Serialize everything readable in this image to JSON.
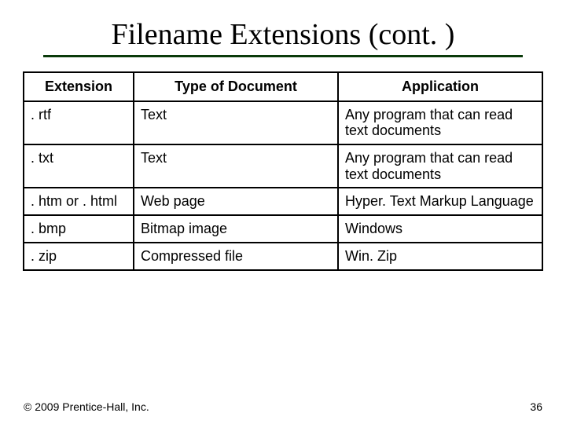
{
  "title": "Filename Extensions (cont. )",
  "headers": {
    "col0": "Extension",
    "col1": "Type of Document",
    "col2": "Application"
  },
  "rows": [
    {
      "ext": ". rtf",
      "type": "Text",
      "app": "Any program that can read text documents"
    },
    {
      "ext": ". txt",
      "type": "Text",
      "app": "Any program that can read text documents"
    },
    {
      "ext": ". htm or . html",
      "type": "Web page",
      "app": "Hyper. Text Markup Language"
    },
    {
      "ext": ". bmp",
      "type": "Bitmap image",
      "app": "Windows"
    },
    {
      "ext": ". zip",
      "type": "Compressed file",
      "app": "Win. Zip"
    }
  ],
  "footer": "© 2009 Prentice-Hall, Inc.",
  "page_number": "36"
}
